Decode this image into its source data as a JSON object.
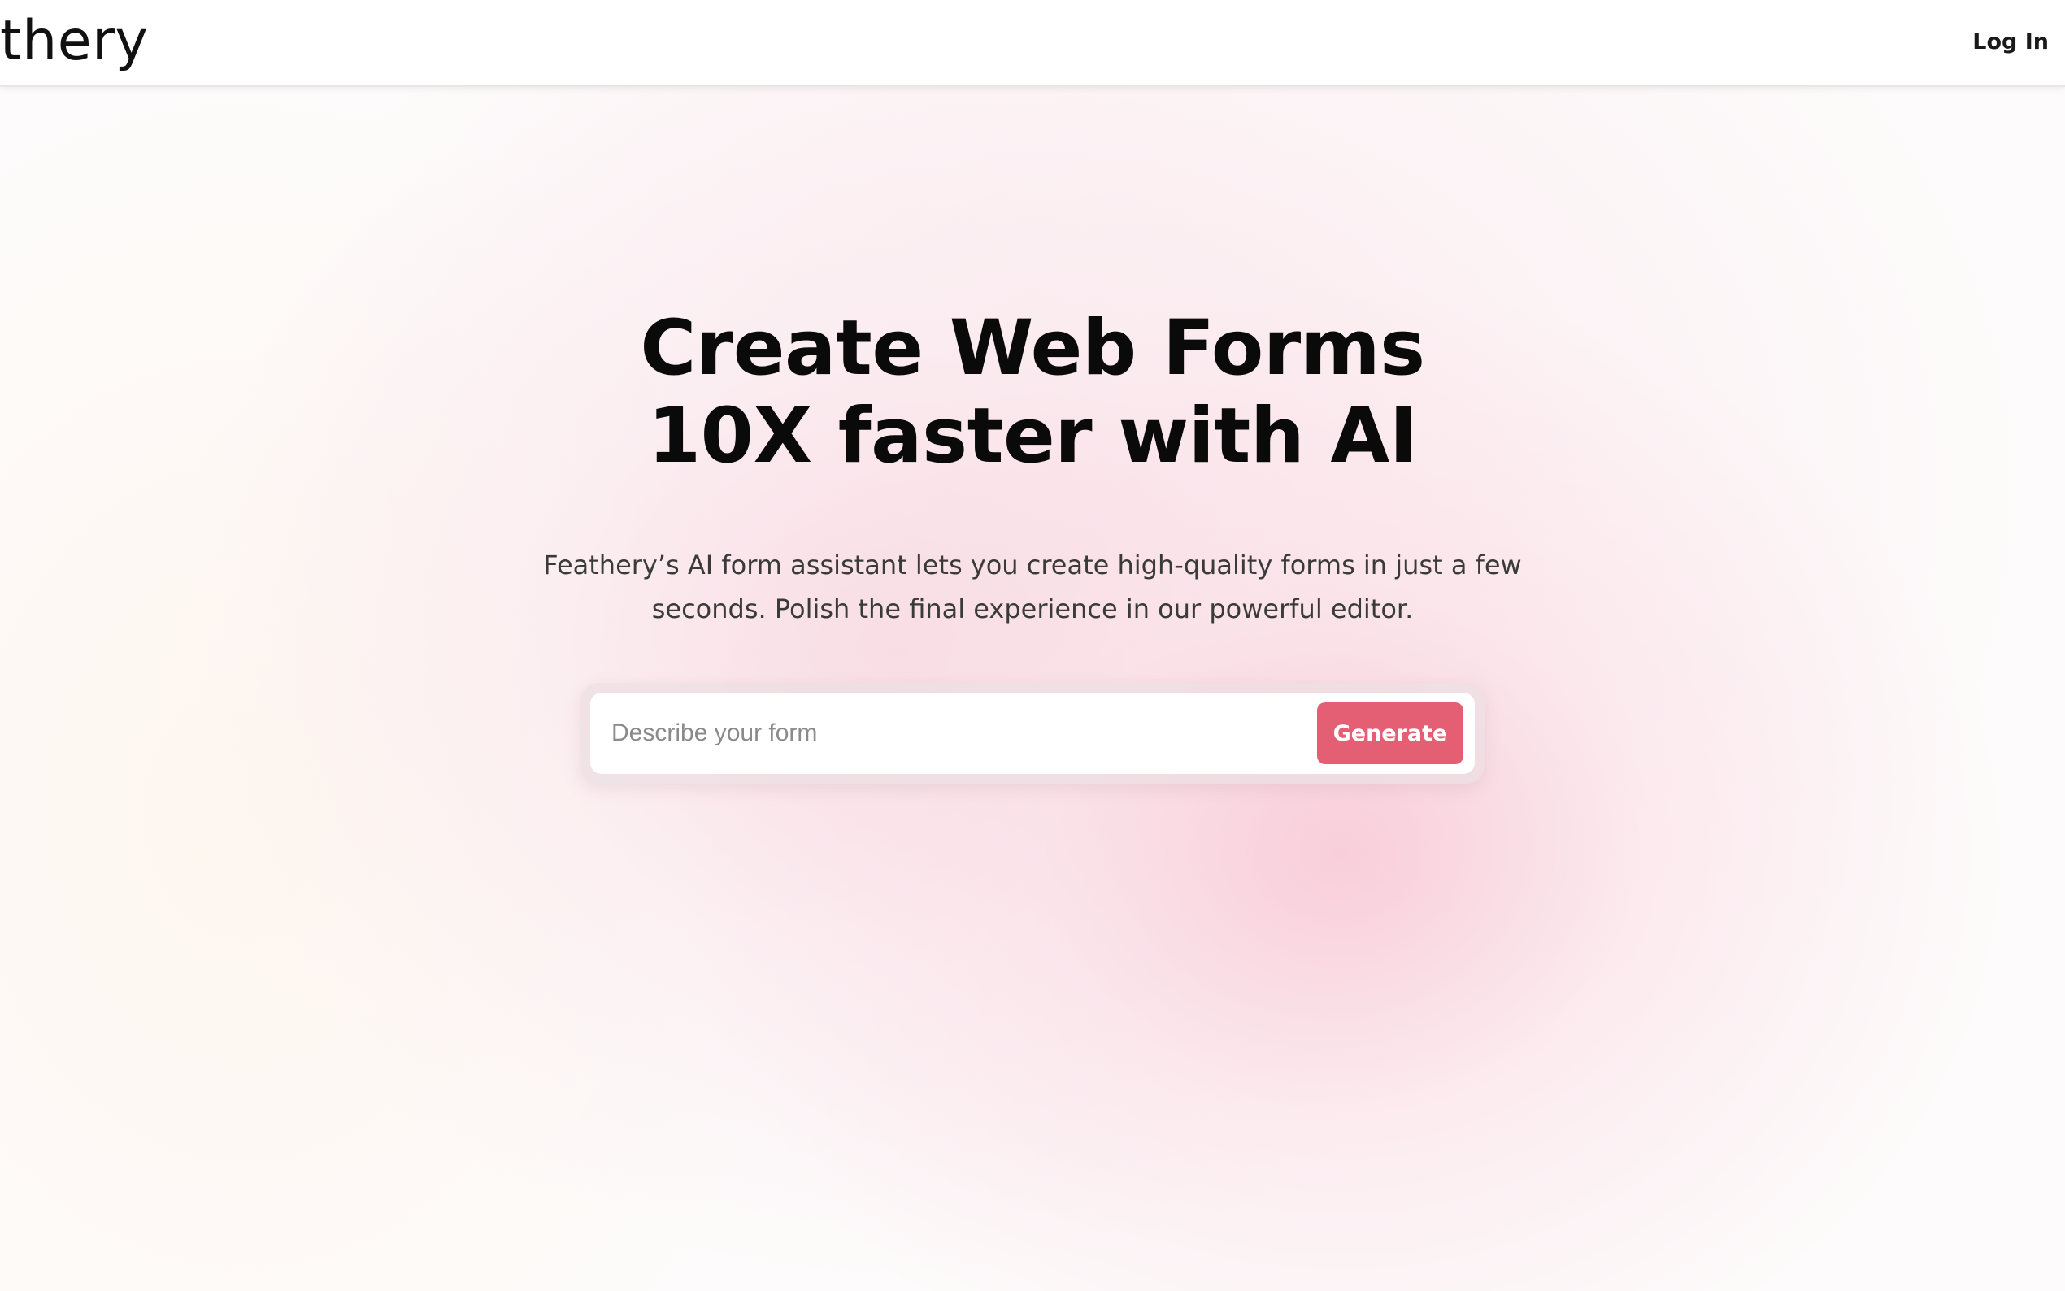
{
  "header": {
    "logo_text": "thery",
    "login_label": "Log In"
  },
  "hero": {
    "title_line1": "Create Web Forms",
    "title_line2": "10X faster with AI",
    "subtitle_line1": "Feathery’s AI form assistant lets you create high-quality forms in just a few",
    "subtitle_line2": "seconds. Polish the final experience in our powerful editor."
  },
  "form_prompt": {
    "placeholder": "Describe your form",
    "value": "",
    "generate_label": "Generate"
  },
  "colors": {
    "accent": "#e45f73",
    "background_tint": "#f8c8d6"
  }
}
